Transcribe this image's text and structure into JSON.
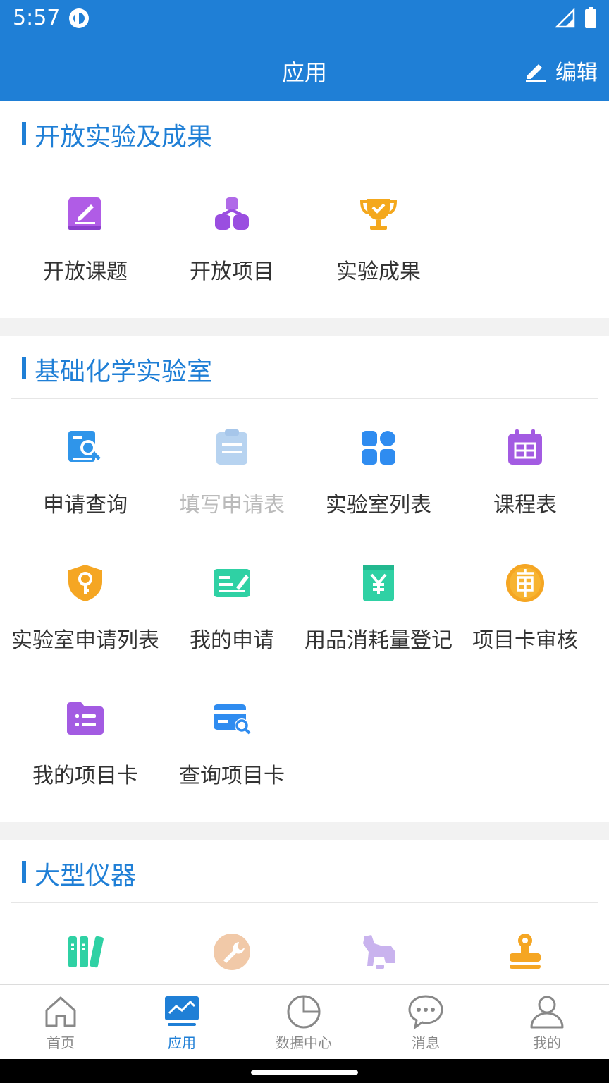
{
  "status": {
    "time": "5:57"
  },
  "header": {
    "title": "应用",
    "edit_label": "编辑"
  },
  "sections": [
    {
      "title": "开放实验及成果",
      "items": [
        {
          "label": "开放课题",
          "icon": "edit-book-icon",
          "color": "#b05ce6"
        },
        {
          "label": "开放项目",
          "icon": "hierarchy-icon",
          "color": "#9a4ee0"
        },
        {
          "label": "实验成果",
          "icon": "trophy-icon",
          "color": "#f4a81d"
        }
      ]
    },
    {
      "title": "基础化学实验室",
      "items": [
        {
          "label": "申请查询",
          "icon": "search-document-icon",
          "color": "#2f95ea"
        },
        {
          "label": "填写申请表",
          "icon": "clipboard-icon",
          "color": "#b7d3f0",
          "disabled": true
        },
        {
          "label": "实验室列表",
          "icon": "apps-grid-icon",
          "color": "#2f8cf0"
        },
        {
          "label": "课程表",
          "icon": "calendar-icon",
          "color": "#a35be2"
        },
        {
          "label": "实验室申请列表",
          "icon": "shield-key-icon",
          "color": "#f5a623"
        },
        {
          "label": "我的申请",
          "icon": "signature-card-icon",
          "color": "#2fd1a4"
        },
        {
          "label": "用品消耗量登记",
          "icon": "yen-receipt-icon",
          "color": "#2fd1a4"
        },
        {
          "label": "项目卡审核",
          "icon": "approval-badge-icon",
          "color": "#f5a623"
        },
        {
          "label": "我的项目卡",
          "icon": "folder-list-icon",
          "color": "#a35be2"
        },
        {
          "label": "查询项目卡",
          "icon": "card-search-icon",
          "color": "#2f8cf0"
        }
      ]
    },
    {
      "title": "大型仪器",
      "items": [
        {
          "icon": "books-icon",
          "color": "#2fd1a4"
        },
        {
          "icon": "wrench-icon",
          "color": "#f1c9a8"
        },
        {
          "icon": "microscope-icon",
          "color": "#c9b3ee"
        },
        {
          "icon": "stamp-icon",
          "color": "#f5a623"
        }
      ]
    }
  ],
  "tabs": [
    {
      "label": "首页",
      "icon": "home-icon"
    },
    {
      "label": "应用",
      "icon": "chart-screen-icon",
      "active": true
    },
    {
      "label": "数据中心",
      "icon": "pie-chart-icon"
    },
    {
      "label": "消息",
      "icon": "chat-bubble-icon"
    },
    {
      "label": "我的",
      "icon": "user-icon"
    }
  ],
  "colors": {
    "primary": "#1f7fd6",
    "text": "#333333",
    "inactive": "#888888"
  }
}
